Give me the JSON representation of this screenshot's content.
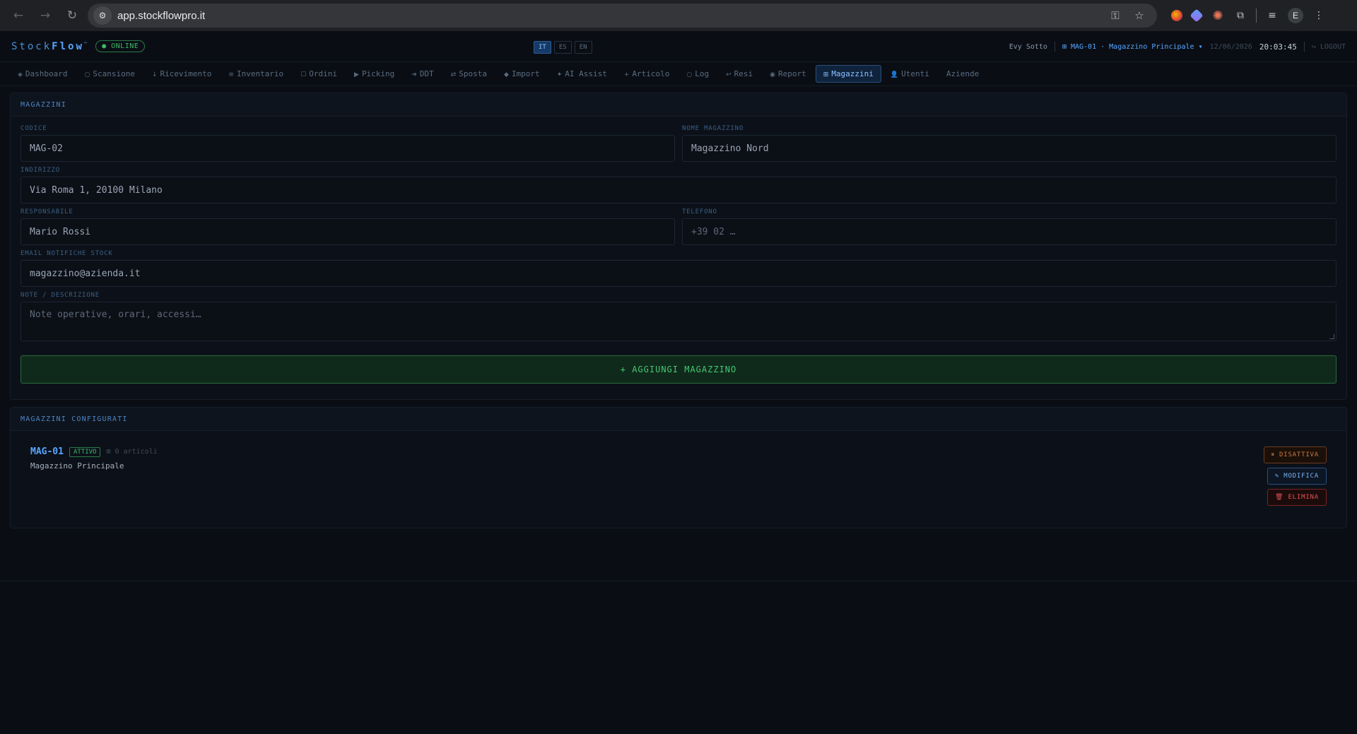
{
  "browser": {
    "url": "app.stockflowpro.it",
    "avatar_letter": "E"
  },
  "header": {
    "logo_prefix": "Stock",
    "logo_bold": "Flow",
    "logo_tm": "™",
    "online": "● ONLINE",
    "languages": [
      "IT",
      "ES",
      "EN"
    ],
    "active_language": "IT",
    "user": "Evy Sotto",
    "warehouse_selector": "⊞ MAG-01 · Magazzino Principale ▾",
    "date": "12/06/2026",
    "time": "20:03:45",
    "logout": "↪ LOGOUT"
  },
  "tabs": [
    {
      "icon": "◈",
      "label": "Dashboard"
    },
    {
      "icon": "○",
      "label": "Scansione"
    },
    {
      "icon": "↓",
      "label": "Ricevimento"
    },
    {
      "icon": "≡",
      "label": "Inventario"
    },
    {
      "icon": "☐",
      "label": "Ordini"
    },
    {
      "icon": "▶",
      "label": "Picking"
    },
    {
      "icon": "➔",
      "label": "DDT"
    },
    {
      "icon": "⇄",
      "label": "Sposta"
    },
    {
      "icon": "◆",
      "label": "Import"
    },
    {
      "icon": "✦",
      "label": "AI Assist"
    },
    {
      "icon": "+",
      "label": "Articolo"
    },
    {
      "icon": "○",
      "label": "Log"
    },
    {
      "icon": "↩",
      "label": "Resi"
    },
    {
      "icon": "◉",
      "label": "Report"
    },
    {
      "icon": "⊞",
      "label": "Magazzini"
    },
    {
      "icon": "👤",
      "label": "Utenti"
    },
    {
      "icon": "",
      "label": "Aziende"
    }
  ],
  "active_tab": "Magazzini",
  "form": {
    "title": "MAGAZZINI",
    "code_label": "CODICE",
    "code_value": "MAG-02",
    "name_label": "NOME MAGAZZINO",
    "name_value": "Magazzino Nord",
    "address_label": "INDIRIZZO",
    "address_value": "Via Roma 1, 20100 Milano",
    "manager_label": "RESPONSABILE",
    "manager_value": "Mario Rossi",
    "phone_label": "TELEFONO",
    "phone_value": "+39 02 …",
    "email_label": "EMAIL NOTIFICHE STOCK",
    "email_value": "magazzino@azienda.it",
    "notes_label": "NOTE / DESCRIZIONE",
    "notes_placeholder": "Note operative, orari, accessi…",
    "add_button": "+ AGGIUNGI MAGAZZINO"
  },
  "configured": {
    "title": "MAGAZZINI CONFIGURATI",
    "items": [
      {
        "code": "MAG-01",
        "status": "ATTIVO",
        "articles": "⊞ 0 articoli",
        "name": "Magazzino Principale",
        "deactivate": "⏸ DISATTIVA",
        "edit": "✎ MODIFICA",
        "delete": "🗑 ELIMINA"
      }
    ]
  }
}
